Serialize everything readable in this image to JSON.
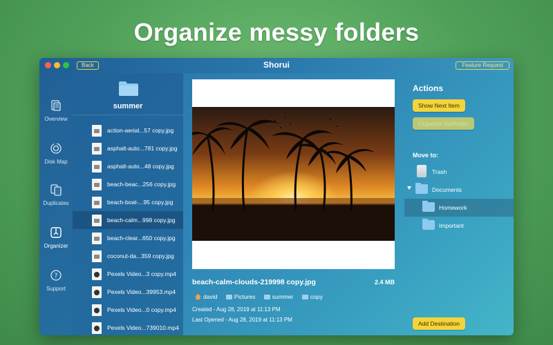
{
  "headline": "Organize messy folders",
  "window": {
    "title": "Shorui",
    "back_label": "Back",
    "feature_request_label": "Feature Request"
  },
  "sidebar": {
    "items": [
      {
        "label": "Overview",
        "icon": "overview-icon"
      },
      {
        "label": "Disk Map",
        "icon": "disk-map-icon"
      },
      {
        "label": "Duplicates",
        "icon": "duplicates-icon"
      },
      {
        "label": "Organizer",
        "icon": "organizer-icon",
        "active": true
      },
      {
        "label": "Support",
        "icon": "support-icon"
      }
    ]
  },
  "folder": {
    "name": "summer"
  },
  "files": [
    {
      "name": "action-aerial...57 copy.jpg",
      "type": "image"
    },
    {
      "name": "asphalt-auto...781 copy.jpg",
      "type": "image"
    },
    {
      "name": "asphalt-auto...48 copy.jpg",
      "type": "image"
    },
    {
      "name": "beach-beac...256 copy.jpg",
      "type": "image"
    },
    {
      "name": "beach-boat-...95 copy.jpg",
      "type": "image"
    },
    {
      "name": "beach-calm...998 copy.jpg",
      "type": "image",
      "selected": true
    },
    {
      "name": "beach-clear...650 copy.jpg",
      "type": "image"
    },
    {
      "name": "coconut-da...359 copy.jpg",
      "type": "image"
    },
    {
      "name": "Pexels Video...3 copy.mp4",
      "type": "video"
    },
    {
      "name": "Pexels Video...39953.mp4",
      "type": "video"
    },
    {
      "name": "Pexels Video...0 copy.mp4",
      "type": "video"
    },
    {
      "name": "Pexels Video...739010.mp4",
      "type": "video"
    }
  ],
  "preview": {
    "file_name": "beach-calm-clouds-219998 copy.jpg",
    "file_size": "2.4 MB",
    "path": [
      "david",
      "Pictures",
      "summer",
      "copy"
    ],
    "created": "Created - Aug 28, 2019 at 11:13 PM",
    "last_opened": "Last Opened - Aug 28, 2019 at 11:13 PM"
  },
  "actions": {
    "title": "Actions",
    "show_next_label": "Show Next Item",
    "organize_subfolder_label": "Organize Subfolder",
    "move_to_label": "Move to:",
    "destinations": [
      {
        "label": "Trash",
        "kind": "trash"
      },
      {
        "label": "Documents",
        "kind": "folder",
        "expanded": true
      },
      {
        "label": "Homework",
        "kind": "folder",
        "selected": true
      },
      {
        "label": "Important",
        "kind": "folder"
      }
    ],
    "add_destination_label": "Add Destination"
  },
  "colors": {
    "accent_yellow": "#f4d43a",
    "folder_blue": "#8fcaf0",
    "background_green": "#5aae63"
  }
}
